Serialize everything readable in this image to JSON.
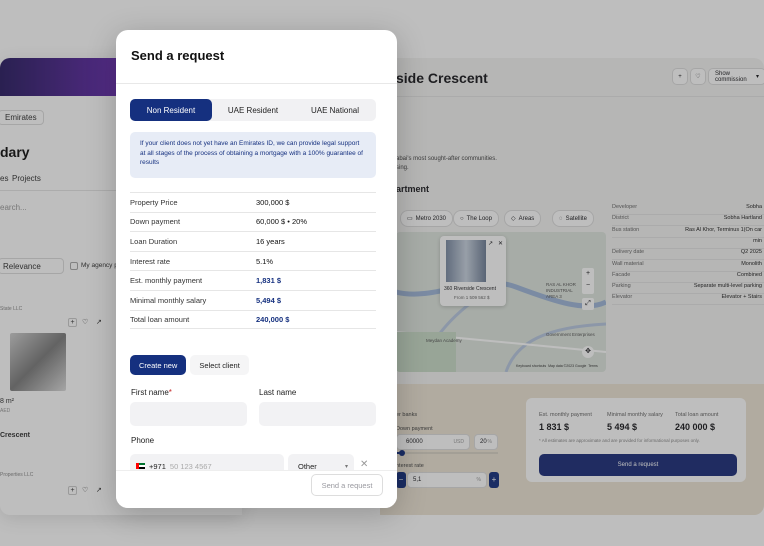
{
  "left_window": {
    "emirates": "Emirates",
    "heading": "dary",
    "tabs": [
      "es",
      "Projects"
    ],
    "search_placeholder": "earch...",
    "filter_select": "Relevance",
    "agency_check": "My agency proj",
    "dev_label": "State LLC",
    "area": "8 m²",
    "aed": "AED",
    "name": "Crescent",
    "dev_label2": "Properties LLC"
  },
  "right_window": {
    "title": "side Crescent",
    "show_commission": "Show commission",
    "desc_line1": "abai's most sought-after communities.",
    "desc_line2": "sing.",
    "apartment_heading": "artment",
    "chips": [
      "Metro 2030",
      "The Loop",
      "Areas",
      "Satellite"
    ],
    "map": {
      "popup_title": "360 Riverside Crescent",
      "popup_price": "From 1 509 562 $",
      "labels": [
        "RAS AL KHOR",
        "INDUSTRIAL",
        "AREA 3",
        "Government Enterprises",
        "Meydan Academy",
        "Keyboard shortcuts",
        "Map data ©2023 Google",
        "Terms"
      ]
    },
    "details": [
      {
        "k": "Developer",
        "v": "Sobha"
      },
      {
        "k": "District",
        "v": "Sobha Hartland"
      },
      {
        "k": "Bus station",
        "v": "Ras Al Khor, Terminus 1(On car"
      },
      {
        "k": "",
        "v": "min"
      },
      {
        "k": "Delivery date",
        "v": "Q2 2025"
      },
      {
        "k": "Wall material",
        "v": "Monolith"
      },
      {
        "k": "Facade",
        "v": "Combined"
      },
      {
        "k": "Parking",
        "v": "Separate multi-level parking"
      },
      {
        "k": "Elevator",
        "v": "Elevator + Stairs"
      }
    ],
    "calc": {
      "banks_label": "er banks",
      "down_payment_label": "Down payment",
      "down_payment_value": "60000",
      "down_payment_cur": "USD",
      "down_payment_pct": "20",
      "pct_sign": "%",
      "interest_label": "nterest rate",
      "interest_value": "5,1",
      "card": {
        "labels": [
          "Est. monthly payment",
          "Minimal monthly salary",
          "Total loan amount"
        ],
        "values": [
          "1 831 $",
          "5 494 $",
          "240 000 $"
        ],
        "note": "* All estimates are approximate and are provided for informational purposes only.",
        "button": "Send a request"
      }
    }
  },
  "modal": {
    "title": "Send a request",
    "segments": [
      "Non Resident",
      "UAE Resident",
      "UAE National"
    ],
    "active_segment": 0,
    "info": "If your client does not yet have an Emirates ID, we can provide legal support at all stages of the process of obtaining a mortgage with a 100% guarantee of results",
    "rows": [
      {
        "label": "Property Price",
        "value": "300,000 $",
        "highlight": false
      },
      {
        "label": "Down payment",
        "value": "60,000 $ • 20%",
        "highlight": false
      },
      {
        "label": "Loan Duration",
        "value": "16 years",
        "highlight": false
      },
      {
        "label": "Interest rate",
        "value": "5.1%",
        "highlight": false
      },
      {
        "label": "Est. monthly payment",
        "value": "1,831 $",
        "highlight": true
      },
      {
        "label": "Minimal monthly salary",
        "value": "5,494 $",
        "highlight": true
      },
      {
        "label": "Total loan amount",
        "value": "240,000 $",
        "highlight": true
      }
    ],
    "client_buttons": [
      "Create new",
      "Select client"
    ],
    "first_name_label": "First name",
    "required_mark": "*",
    "last_name_label": "Last name",
    "phone_label": "Phone",
    "phone_prefix": "+971",
    "phone_value": "50 123 4567",
    "phone_type": "Other",
    "send_button": "Send a request",
    "close_glyph": "✕"
  },
  "colors": {
    "accent": "#15307f",
    "info_bg": "#e7ecf6",
    "calc_bg": "#ece4d4"
  }
}
